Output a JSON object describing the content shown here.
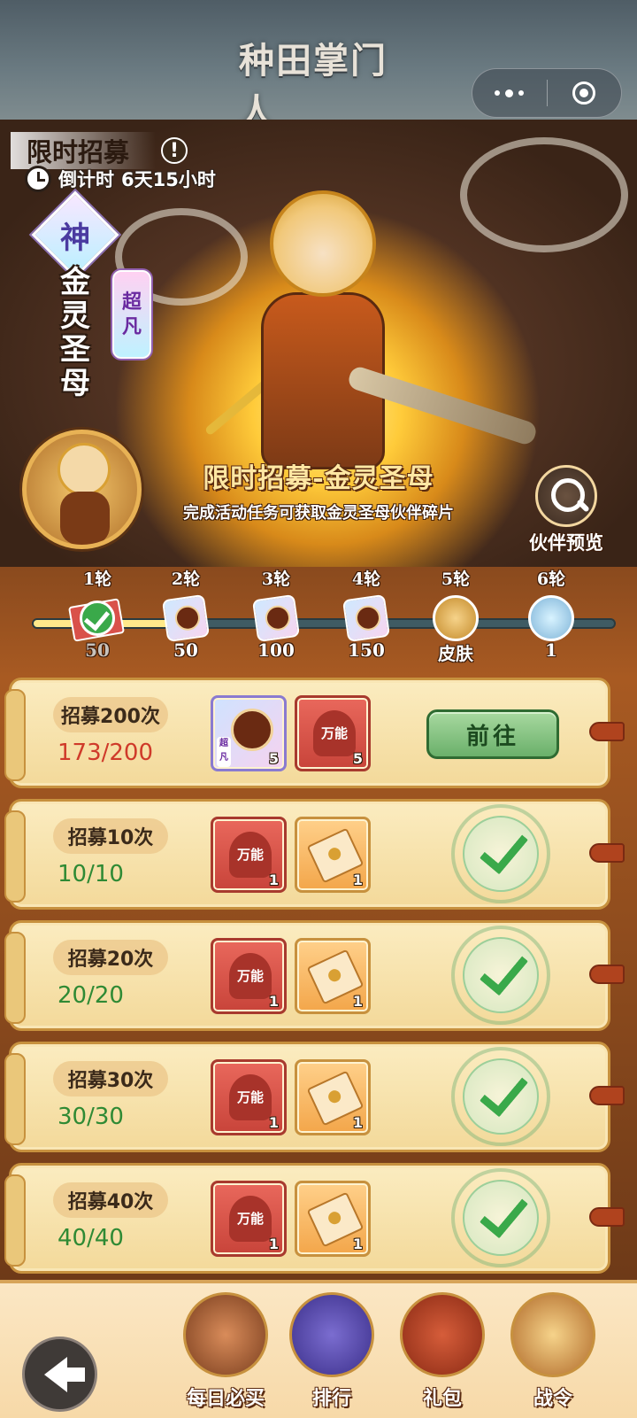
{
  "app": {
    "title": "种田掌门人"
  },
  "event": {
    "title": "限时招募",
    "countdown_label": "倒计时",
    "countdown_value": "6天15小时",
    "rank_badge": "神",
    "hero_name": "金灵圣母",
    "grade": "超凡",
    "banner_title": "限时招募-金灵圣母",
    "banner_subtitle": "完成活动任务可获取金灵圣母伙伴碎片",
    "preview_label": "伙伴预览"
  },
  "rounds": {
    "progress_fraction": 0.27,
    "items": [
      {
        "label": "1轮",
        "value": "50",
        "icon": "check-icon",
        "done": true
      },
      {
        "label": "2轮",
        "value": "50",
        "icon": "hero-card-icon",
        "done": false
      },
      {
        "label": "3轮",
        "value": "100",
        "icon": "hero-card-icon",
        "done": false
      },
      {
        "label": "4轮",
        "value": "150",
        "icon": "hero-card-icon",
        "done": false
      },
      {
        "label": "5轮",
        "value": "皮肤",
        "icon": "skin-icon",
        "done": false
      },
      {
        "label": "6轮",
        "value": "1",
        "icon": "dragon-icon",
        "done": false
      }
    ]
  },
  "tasks": [
    {
      "name": "招募200次",
      "progress": "173/200",
      "complete": false,
      "rewards": [
        {
          "type": "hero",
          "qty": "5"
        },
        {
          "type": "wanneng",
          "label": "万能",
          "qty": "5"
        }
      ],
      "action": "前往"
    },
    {
      "name": "招募10次",
      "progress": "10/10",
      "complete": true,
      "rewards": [
        {
          "type": "wanneng",
          "label": "万能",
          "qty": "1"
        },
        {
          "type": "scroll",
          "qty": "1"
        }
      ]
    },
    {
      "name": "招募20次",
      "progress": "20/20",
      "complete": true,
      "rewards": [
        {
          "type": "wanneng",
          "label": "万能",
          "qty": "1"
        },
        {
          "type": "scroll",
          "qty": "1"
        }
      ]
    },
    {
      "name": "招募30次",
      "progress": "30/30",
      "complete": true,
      "rewards": [
        {
          "type": "wanneng",
          "label": "万能",
          "qty": "1"
        },
        {
          "type": "scroll",
          "qty": "1"
        }
      ]
    },
    {
      "name": "招募40次",
      "progress": "40/40",
      "complete": true,
      "rewards": [
        {
          "type": "wanneng",
          "label": "万能",
          "qty": "1"
        },
        {
          "type": "scroll",
          "qty": "1"
        }
      ]
    }
  ],
  "nav": {
    "items": [
      {
        "label": "每日必买"
      },
      {
        "label": "排行"
      },
      {
        "label": "礼包"
      },
      {
        "label": "战令"
      }
    ]
  },
  "colors": {
    "progress_red": "#cf3a2a",
    "progress_green": "#2f8a34",
    "accent_gold": "#ffe7a3"
  }
}
